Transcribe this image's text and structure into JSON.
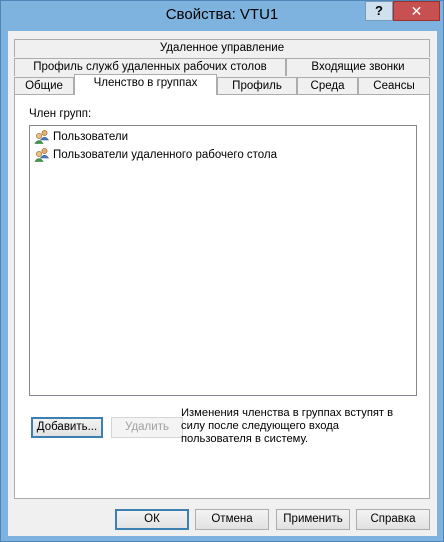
{
  "window": {
    "title": "Свойства: VTU1",
    "help_label": "?",
    "close_label": "✕"
  },
  "tabs": {
    "row1": [
      {
        "label": "Удаленное управление"
      }
    ],
    "row2": [
      {
        "label": "Профиль служб удаленных рабочих столов"
      },
      {
        "label": "Входящие звонки"
      }
    ],
    "row3": [
      {
        "label": "Общие"
      },
      {
        "label": "Членство в группах",
        "selected": true
      },
      {
        "label": "Профиль"
      },
      {
        "label": "Среда"
      },
      {
        "label": "Сеансы"
      }
    ]
  },
  "membership": {
    "label": "Член групп:",
    "groups": [
      {
        "name": "Пользователи",
        "icon": "user-group-icon"
      },
      {
        "name": "Пользователи удаленного рабочего стола",
        "icon": "user-group-icon"
      }
    ],
    "add_label": "Добавить...",
    "remove_label": "Удалить",
    "note": "Изменения членства в группах вступят в силу после следующего входа пользователя в систему."
  },
  "footer": {
    "ok_label": "ОК",
    "cancel_label": "Отмена",
    "apply_label": "Применить",
    "help_label": "Справка"
  }
}
